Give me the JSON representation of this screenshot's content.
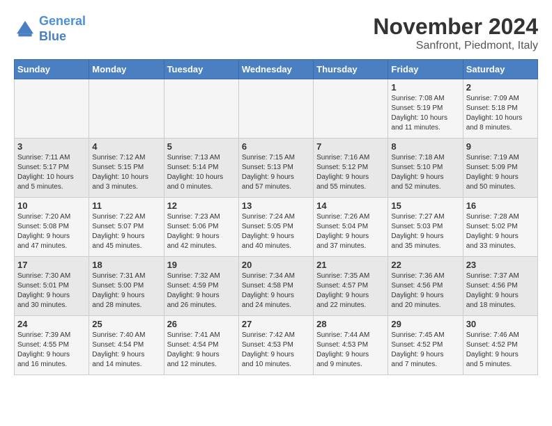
{
  "logo": {
    "line1": "General",
    "line2": "Blue"
  },
  "title": "November 2024",
  "location": "Sanfront, Piedmont, Italy",
  "days_of_week": [
    "Sunday",
    "Monday",
    "Tuesday",
    "Wednesday",
    "Thursday",
    "Friday",
    "Saturday"
  ],
  "weeks": [
    [
      {
        "day": "",
        "info": ""
      },
      {
        "day": "",
        "info": ""
      },
      {
        "day": "",
        "info": ""
      },
      {
        "day": "",
        "info": ""
      },
      {
        "day": "",
        "info": ""
      },
      {
        "day": "1",
        "info": "Sunrise: 7:08 AM\nSunset: 5:19 PM\nDaylight: 10 hours\nand 11 minutes."
      },
      {
        "day": "2",
        "info": "Sunrise: 7:09 AM\nSunset: 5:18 PM\nDaylight: 10 hours\nand 8 minutes."
      }
    ],
    [
      {
        "day": "3",
        "info": "Sunrise: 7:11 AM\nSunset: 5:17 PM\nDaylight: 10 hours\nand 5 minutes."
      },
      {
        "day": "4",
        "info": "Sunrise: 7:12 AM\nSunset: 5:15 PM\nDaylight: 10 hours\nand 3 minutes."
      },
      {
        "day": "5",
        "info": "Sunrise: 7:13 AM\nSunset: 5:14 PM\nDaylight: 10 hours\nand 0 minutes."
      },
      {
        "day": "6",
        "info": "Sunrise: 7:15 AM\nSunset: 5:13 PM\nDaylight: 9 hours\nand 57 minutes."
      },
      {
        "day": "7",
        "info": "Sunrise: 7:16 AM\nSunset: 5:12 PM\nDaylight: 9 hours\nand 55 minutes."
      },
      {
        "day": "8",
        "info": "Sunrise: 7:18 AM\nSunset: 5:10 PM\nDaylight: 9 hours\nand 52 minutes."
      },
      {
        "day": "9",
        "info": "Sunrise: 7:19 AM\nSunset: 5:09 PM\nDaylight: 9 hours\nand 50 minutes."
      }
    ],
    [
      {
        "day": "10",
        "info": "Sunrise: 7:20 AM\nSunset: 5:08 PM\nDaylight: 9 hours\nand 47 minutes."
      },
      {
        "day": "11",
        "info": "Sunrise: 7:22 AM\nSunset: 5:07 PM\nDaylight: 9 hours\nand 45 minutes."
      },
      {
        "day": "12",
        "info": "Sunrise: 7:23 AM\nSunset: 5:06 PM\nDaylight: 9 hours\nand 42 minutes."
      },
      {
        "day": "13",
        "info": "Sunrise: 7:24 AM\nSunset: 5:05 PM\nDaylight: 9 hours\nand 40 minutes."
      },
      {
        "day": "14",
        "info": "Sunrise: 7:26 AM\nSunset: 5:04 PM\nDaylight: 9 hours\nand 37 minutes."
      },
      {
        "day": "15",
        "info": "Sunrise: 7:27 AM\nSunset: 5:03 PM\nDaylight: 9 hours\nand 35 minutes."
      },
      {
        "day": "16",
        "info": "Sunrise: 7:28 AM\nSunset: 5:02 PM\nDaylight: 9 hours\nand 33 minutes."
      }
    ],
    [
      {
        "day": "17",
        "info": "Sunrise: 7:30 AM\nSunset: 5:01 PM\nDaylight: 9 hours\nand 30 minutes."
      },
      {
        "day": "18",
        "info": "Sunrise: 7:31 AM\nSunset: 5:00 PM\nDaylight: 9 hours\nand 28 minutes."
      },
      {
        "day": "19",
        "info": "Sunrise: 7:32 AM\nSunset: 4:59 PM\nDaylight: 9 hours\nand 26 minutes."
      },
      {
        "day": "20",
        "info": "Sunrise: 7:34 AM\nSunset: 4:58 PM\nDaylight: 9 hours\nand 24 minutes."
      },
      {
        "day": "21",
        "info": "Sunrise: 7:35 AM\nSunset: 4:57 PM\nDaylight: 9 hours\nand 22 minutes."
      },
      {
        "day": "22",
        "info": "Sunrise: 7:36 AM\nSunset: 4:56 PM\nDaylight: 9 hours\nand 20 minutes."
      },
      {
        "day": "23",
        "info": "Sunrise: 7:37 AM\nSunset: 4:56 PM\nDaylight: 9 hours\nand 18 minutes."
      }
    ],
    [
      {
        "day": "24",
        "info": "Sunrise: 7:39 AM\nSunset: 4:55 PM\nDaylight: 9 hours\nand 16 minutes."
      },
      {
        "day": "25",
        "info": "Sunrise: 7:40 AM\nSunset: 4:54 PM\nDaylight: 9 hours\nand 14 minutes."
      },
      {
        "day": "26",
        "info": "Sunrise: 7:41 AM\nSunset: 4:54 PM\nDaylight: 9 hours\nand 12 minutes."
      },
      {
        "day": "27",
        "info": "Sunrise: 7:42 AM\nSunset: 4:53 PM\nDaylight: 9 hours\nand 10 minutes."
      },
      {
        "day": "28",
        "info": "Sunrise: 7:44 AM\nSunset: 4:53 PM\nDaylight: 9 hours\nand 9 minutes."
      },
      {
        "day": "29",
        "info": "Sunrise: 7:45 AM\nSunset: 4:52 PM\nDaylight: 9 hours\nand 7 minutes."
      },
      {
        "day": "30",
        "info": "Sunrise: 7:46 AM\nSunset: 4:52 PM\nDaylight: 9 hours\nand 5 minutes."
      }
    ]
  ],
  "colors": {
    "header_bg": "#4a7fc1",
    "odd_row": "#f5f5f5",
    "even_row": "#e8e8e8"
  }
}
